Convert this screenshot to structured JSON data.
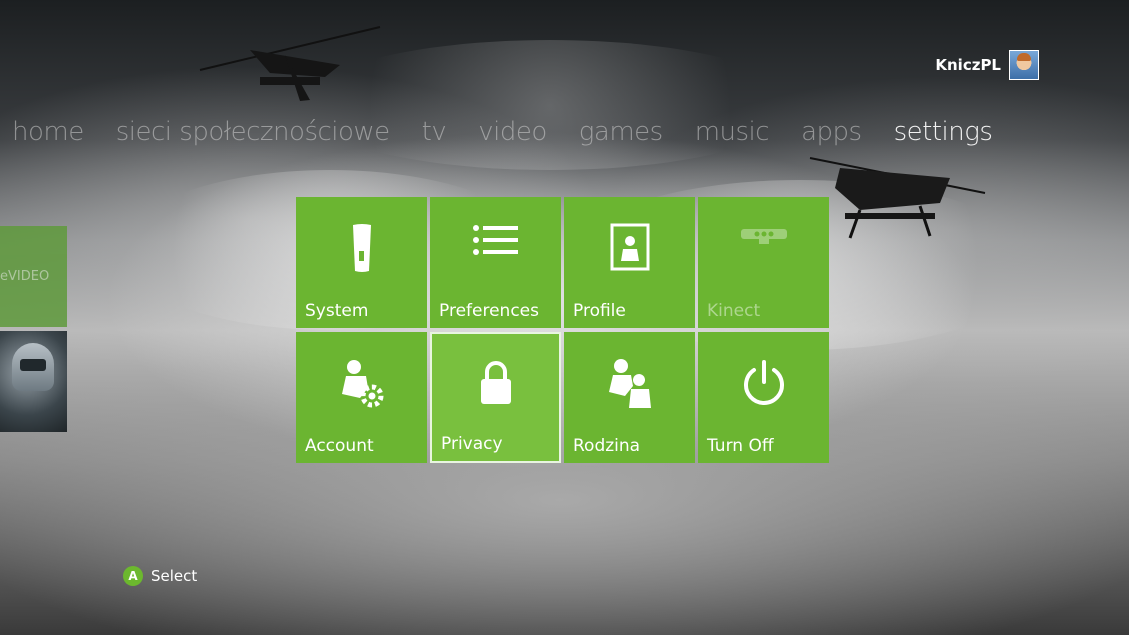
{
  "user": {
    "name": "KniczPL",
    "avatar_icon": "avatar-icon"
  },
  "nav": {
    "items": [
      "home",
      "sieci społecznościowe",
      "tv",
      "video",
      "games",
      "music",
      "apps",
      "settings"
    ],
    "active_index": 7
  },
  "side": {
    "video_label": "eVIDEO"
  },
  "tiles": [
    {
      "label": "System",
      "icon": "console-icon"
    },
    {
      "label": "Preferences",
      "icon": "list-icon"
    },
    {
      "label": "Profile",
      "icon": "profile-icon"
    },
    {
      "label": "Kinect",
      "icon": "kinect-icon",
      "disabled": true
    },
    {
      "label": "Account",
      "icon": "account-gear-icon"
    },
    {
      "label": "Privacy",
      "icon": "lock-icon",
      "selected": true
    },
    {
      "label": "Rodzina",
      "icon": "family-icon"
    },
    {
      "label": "Turn Off",
      "icon": "power-icon"
    }
  ],
  "hint": {
    "button": "A",
    "label": "Select"
  },
  "colors": {
    "tile": "#6bb531",
    "accent": "#6cb82e"
  }
}
